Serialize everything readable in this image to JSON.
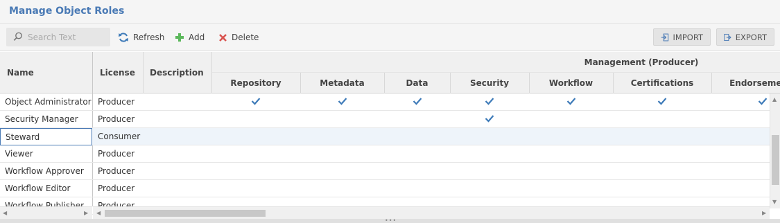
{
  "title": "Manage Object Roles",
  "toolbar": {
    "search_placeholder": "Search Text",
    "refresh_label": "Refresh",
    "add_label": "Add",
    "delete_label": "Delete",
    "import_label": "IMPORT",
    "export_label": "EXPORT"
  },
  "grid": {
    "headers": {
      "name": "Name",
      "license": "License",
      "description": "Description",
      "group": "Management (Producer)",
      "columns": [
        "Repository",
        "Metadata",
        "Data",
        "Security",
        "Workflow",
        "Certifications",
        "Endorsements"
      ]
    },
    "rows": [
      {
        "name": "Object Administrator",
        "license": "Producer",
        "description": "",
        "checks": [
          true,
          true,
          true,
          true,
          true,
          true,
          true
        ]
      },
      {
        "name": "Security Manager",
        "license": "Producer",
        "description": "",
        "checks": [
          false,
          false,
          false,
          true,
          false,
          false,
          false
        ]
      },
      {
        "name": "Steward",
        "license": "Consumer",
        "description": "",
        "checks": [
          false,
          false,
          false,
          false,
          false,
          false,
          false
        ],
        "selected": true
      },
      {
        "name": "Viewer",
        "license": "Producer",
        "description": "",
        "checks": [
          false,
          false,
          false,
          false,
          false,
          false,
          false
        ]
      },
      {
        "name": "Workflow Approver",
        "license": "Producer",
        "description": "",
        "checks": [
          false,
          false,
          false,
          false,
          false,
          false,
          false
        ]
      },
      {
        "name": "Workflow Editor",
        "license": "Producer",
        "description": "",
        "checks": [
          false,
          false,
          false,
          false,
          false,
          false,
          false
        ]
      },
      {
        "name": "Workflow Publisher",
        "license": "Producer",
        "description": "",
        "checks": [
          false,
          false,
          false,
          false,
          false,
          false,
          false
        ]
      }
    ]
  },
  "colors": {
    "title": "#4a7ab5",
    "check": "#3d7ab8",
    "refresh_icon": "#3d7ab8",
    "add_icon": "#5cb85c",
    "delete_icon": "#d9534f",
    "selected_row": "#eef4fa",
    "selected_border": "#4a7ab5"
  }
}
